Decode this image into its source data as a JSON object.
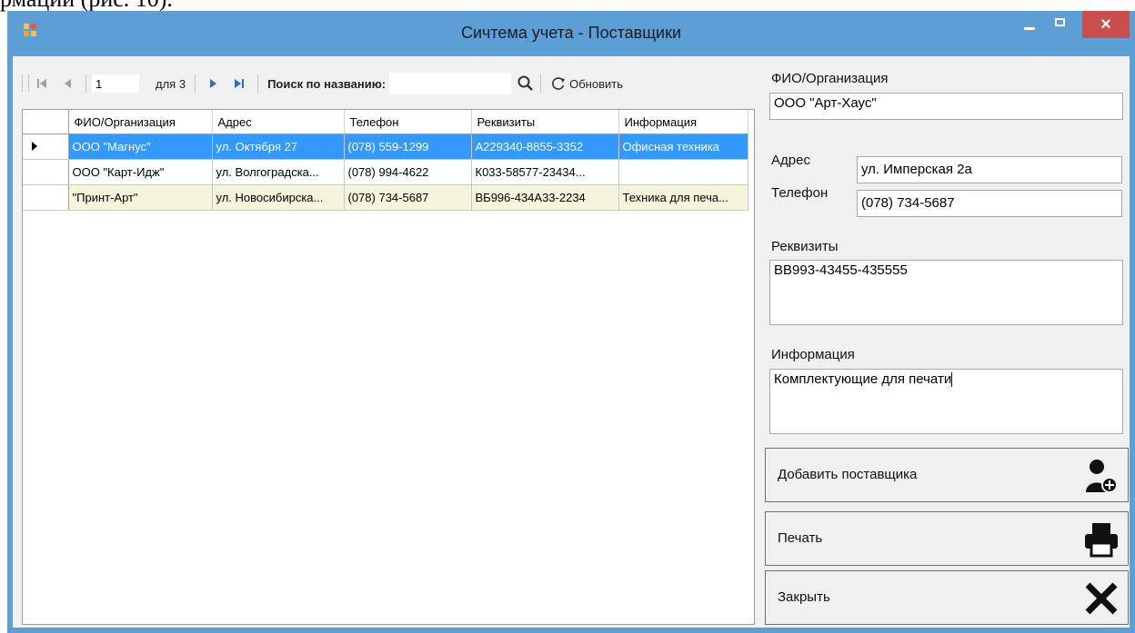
{
  "document": {
    "fragment_text": "рмации (рис. 10)."
  },
  "window": {
    "title": "Сичтема учета - Поставщики",
    "icons": {
      "app": "app-icon",
      "minimize": "minimize-icon",
      "maximize": "maximize-icon",
      "close": "close-icon"
    },
    "close_glyph": "×",
    "colors": {
      "titlebar": "#5b9fd6",
      "close": "#c94f4c",
      "selection": "#3399ff",
      "alt_row": "#f5f5dc"
    }
  },
  "toolbar": {
    "current_page": "1",
    "page_of": "для 3",
    "search_label": "Поиск по названию:",
    "search_value": "",
    "refresh_label": "Обновить",
    "icons": [
      "move-first-icon",
      "move-prev-icon",
      "move-next-icon",
      "move-last-icon",
      "search-icon",
      "refresh-icon"
    ]
  },
  "table": {
    "headers": [
      "ФИО/Организация",
      "Адрес",
      "Телефон",
      "Реквизиты",
      "Информация"
    ],
    "rows": [
      [
        "ООО \"Магнус\"",
        "ул. Октября 27",
        "(078) 559-1299",
        "А229340-8855-3352",
        "Офисная техника"
      ],
      [
        "ООО \"Карт-Идж\"",
        "ул. Волгоградска...",
        "(078) 994-4622",
        "К033-58577-23434...",
        ""
      ],
      [
        "\"Принт-Арт\"",
        "ул. Новосибирска...",
        "(078) 734-5687",
        "ВБ996-434А33-2234",
        "Техника для печа..."
      ]
    ],
    "selected_row": 0
  },
  "form": {
    "org_label": "ФИО/Организация",
    "org_value": "ООО \"Арт-Хаус\"",
    "address_label": "Адрес",
    "address_value": "ул. Имперская 2а",
    "phone_label": "Телефон",
    "phone_value": "(078) 734-5687",
    "requisites_label": "Реквизиты",
    "requisites_value": "ВВ993-43455-435555",
    "info_label": "Информация",
    "info_value": "Комплектующие для печати"
  },
  "buttons": {
    "add_label": "Добавить поставщика",
    "add_icon": "add-user-icon",
    "print_label": "Печать",
    "print_icon": "printer-icon",
    "close_label": "Закрыть",
    "close_icon": "close-x-icon"
  }
}
